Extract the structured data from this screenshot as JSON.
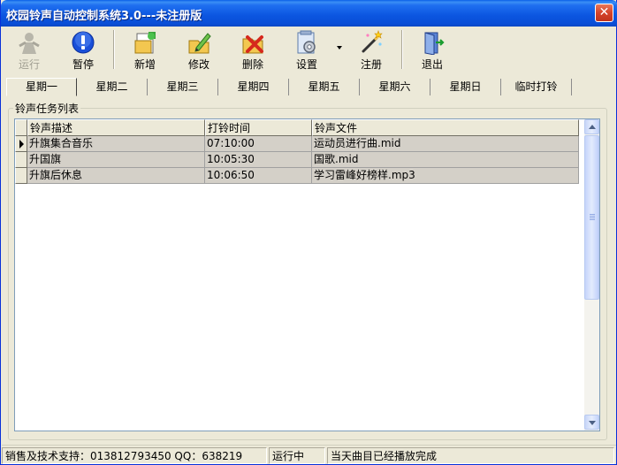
{
  "window": {
    "title": "校园铃声自动控制系统3.0---未注册版",
    "close_glyph": "✕"
  },
  "toolbar": {
    "buttons": [
      {
        "label": "运行",
        "icon": "run-icon",
        "enabled": false
      },
      {
        "label": "暂停",
        "icon": "pause-icon",
        "enabled": true
      },
      {
        "label": "新增",
        "icon": "add-icon",
        "enabled": true
      },
      {
        "label": "修改",
        "icon": "edit-icon",
        "enabled": true
      },
      {
        "label": "删除",
        "icon": "delete-icon",
        "enabled": true
      },
      {
        "label": "设置",
        "icon": "settings-icon",
        "enabled": true,
        "has_dropdown": true
      },
      {
        "label": "注册",
        "icon": "register-icon",
        "enabled": true
      },
      {
        "label": "退出",
        "icon": "exit-icon",
        "enabled": true
      }
    ]
  },
  "tabs": [
    {
      "label": "星期一",
      "active": true
    },
    {
      "label": "星期二",
      "active": false
    },
    {
      "label": "星期三",
      "active": false
    },
    {
      "label": "星期四",
      "active": false
    },
    {
      "label": "星期五",
      "active": false
    },
    {
      "label": "星期六",
      "active": false
    },
    {
      "label": "星期日",
      "active": false
    },
    {
      "label": "临时打铃",
      "active": false
    }
  ],
  "task_list": {
    "title": "铃声任务列表",
    "columns": [
      "铃声描述",
      "打铃时间",
      "铃声文件"
    ],
    "rows": [
      [
        "升旗集合音乐",
        "07:10:00",
        "运动员进行曲.mid"
      ],
      [
        "升国旗",
        "10:05:30",
        "国歌.mid"
      ],
      [
        "升旗后休息",
        "10:06:50",
        "学习雷峰好榜样.mp3"
      ]
    ],
    "current_row": 0
  },
  "status": {
    "support": "销售及技术支持：013812793450  QQ：638219",
    "state": "运行中",
    "message": "当天曲目已经播放完成"
  },
  "colors": {
    "titlebar": "#0a55e0",
    "window_bg": "#ece9d8",
    "row_bg": "#d4d0c8"
  }
}
